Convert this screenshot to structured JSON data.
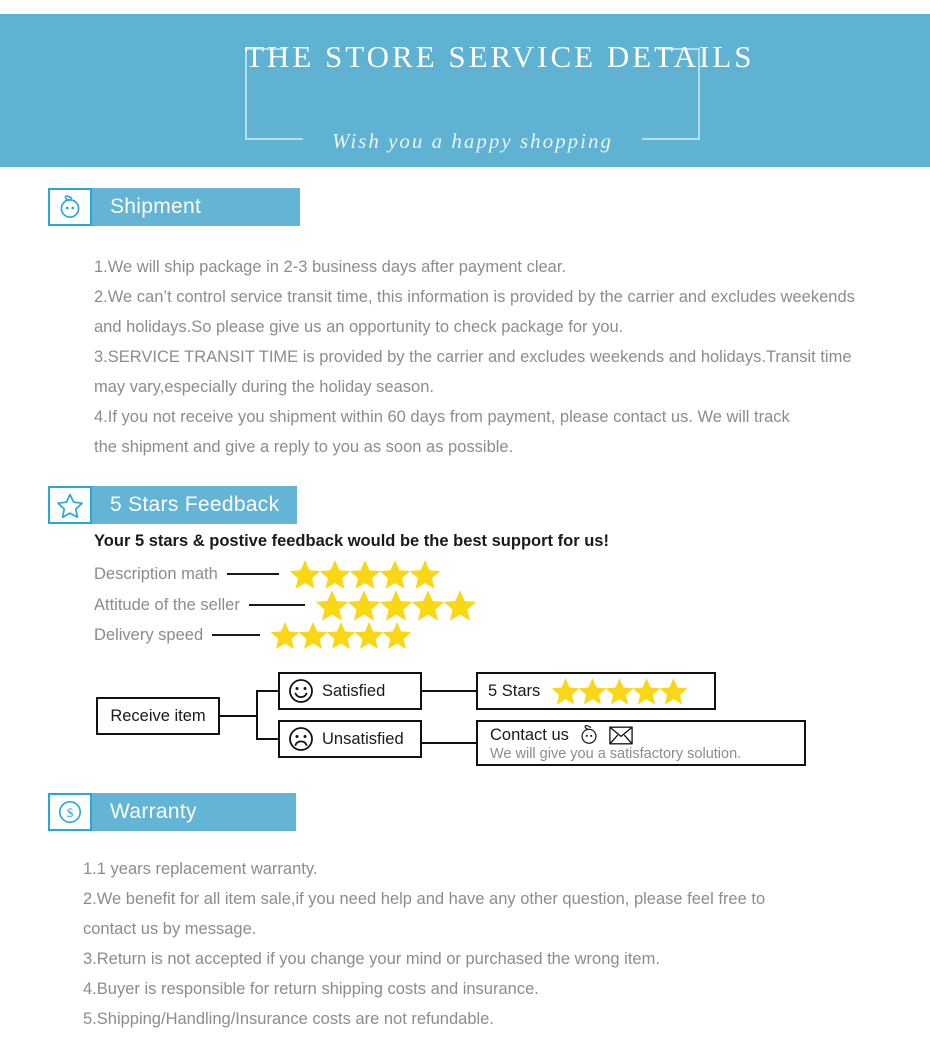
{
  "banner": {
    "title": "THE STORE SERVICE DETAILS",
    "subtitle": "Wish you a happy shopping",
    "bg_color": "#5fb2d2"
  },
  "theme": {
    "accent_blue": "#63b4d5",
    "icon_border": "#29a8d8",
    "star_yellow": "#fad714",
    "body_text": "#8c8c8c"
  },
  "sections": [
    {
      "id": "shipment",
      "label": "Shipment",
      "icon": "chat-face-icon",
      "items": [
        "1.We will ship package in 2-3 business days after payment clear.",
        "2.We can’t control service transit time, this information is provided by the carrier and excludes weekends",
        "  and holidays.So please give us an opportunity to check package for you.",
        "3.SERVICE TRANSIT TIME is provided by the carrier and excludes weekends and holidays.Transit time",
        "  may vary,especially during the holiday season.",
        "4.If you not receive you shipment within 60 days from payment, please contact us. We will track",
        "  the shipment and give a reply to you as soon as possible."
      ]
    },
    {
      "id": "feedback",
      "label": "5 Stars Feedback",
      "icon": "star-outline-icon"
    },
    {
      "id": "warranty",
      "label": "Warranty",
      "icon": "dollar-circle-icon",
      "items": [
        "1.1 years replacement warranty.",
        "2.We benefit for all item sale,if you need help and have any other question, please feel free to",
        "   contact us by message.",
        "3.Return is not accepted if you change your mind or purchased the wrong item.",
        "4.Buyer is responsible for return shipping costs and insurance.",
        "5.Shipping/Handling/Insurance costs are not refundable."
      ]
    }
  ],
  "feedback": {
    "lead": "Your 5 stars & postive feedback would be the best support for us!",
    "ratings": [
      {
        "label": "Description math",
        "stars": 5
      },
      {
        "label": "Attitude of the seller",
        "stars": 5
      },
      {
        "label": "Delivery speed",
        "stars": 5
      }
    ]
  },
  "flow": {
    "receive": "Receive item",
    "satisfied": "Satisfied",
    "unsatisfied": "Unsatisfied",
    "five_stars": "5 Stars",
    "five_stars_count": 5,
    "contact_title": "Contact us",
    "contact_note": "We will give you a satisfactory solution."
  }
}
